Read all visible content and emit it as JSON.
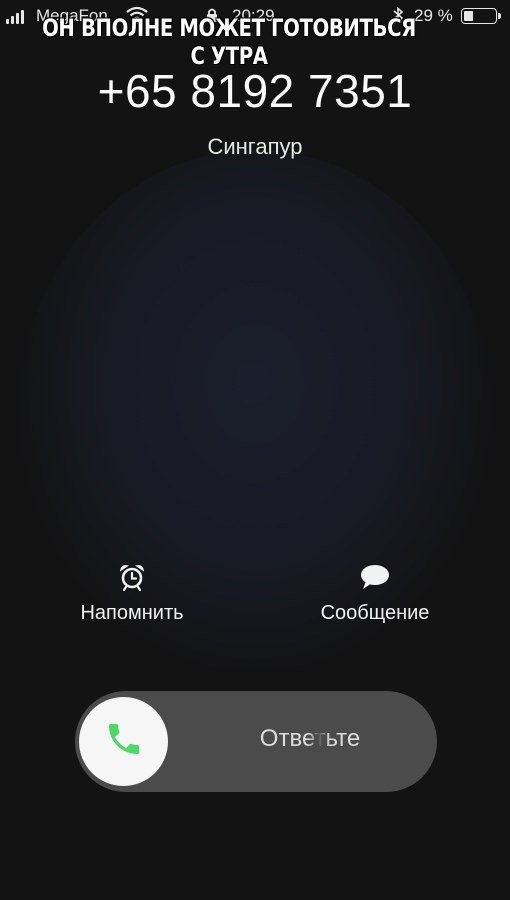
{
  "status_bar": {
    "carrier": "MegaFon",
    "time": "20:29",
    "battery_percent": "29 %",
    "battery_level": 0.29,
    "signal_icon": "signal-bars-icon",
    "wifi_icon": "wifi-icon",
    "lock_icon": "orientation-lock-icon",
    "bluetooth_icon": "bluetooth-icon",
    "battery_icon": "battery-icon"
  },
  "caption": "ОН ВПОЛНЕ МОЖЕТ ГОТОВИТЬСЯ С УТРА",
  "call": {
    "number": "+65 8192 7351",
    "location": "Сингапур"
  },
  "actions": {
    "remind": {
      "label": "Напомнить",
      "icon": "alarm-clock-icon"
    },
    "message": {
      "label": "Сообщение",
      "icon": "speech-bubble-icon"
    }
  },
  "slider": {
    "label": "Ответьте",
    "icon": "phone-icon",
    "accent_color": "#4cd964"
  }
}
